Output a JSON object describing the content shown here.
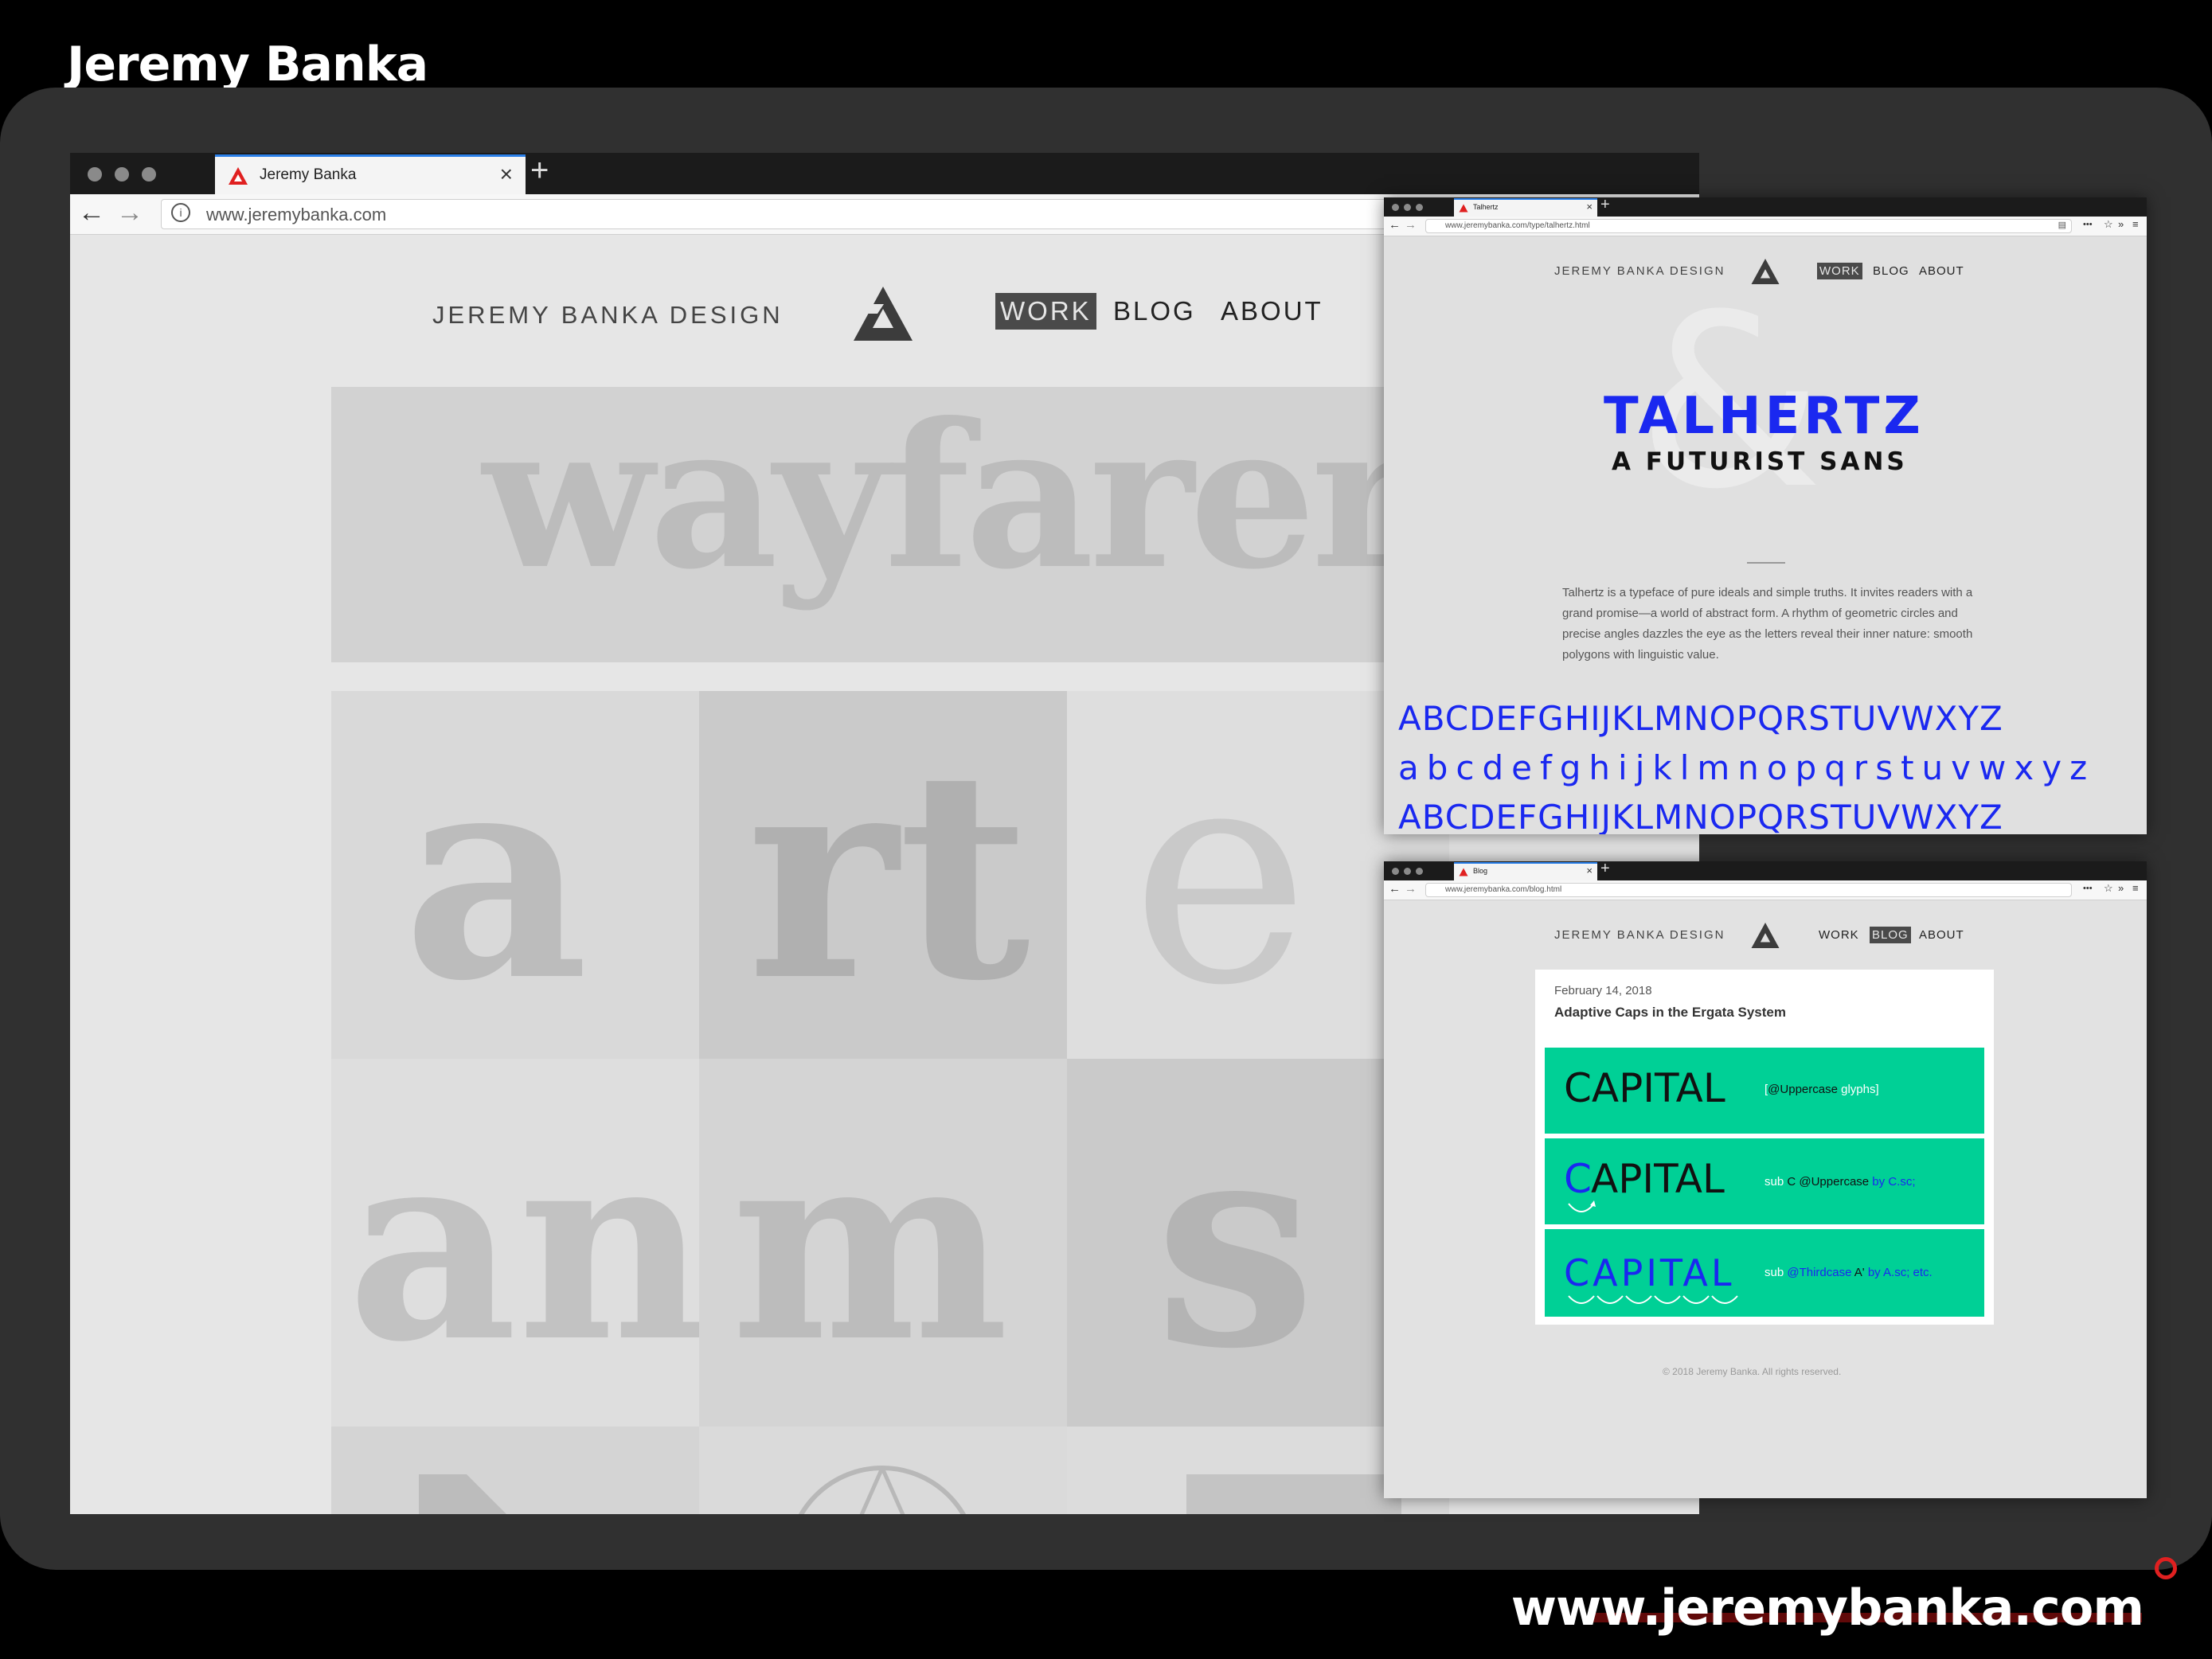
{
  "header": {
    "title": "Jeremy Banka"
  },
  "footer": {
    "url": "www.jeremybanka.com"
  },
  "main_browser": {
    "tab_title": "Jeremy Banka",
    "url": "www.jeremybanka.com",
    "site": {
      "name": "JEREMY BANKA DESIGN",
      "nav": [
        "WORK",
        "BLOG",
        "ABOUT"
      ],
      "active_nav": "WORK"
    },
    "tiles": {
      "banner": "wayfarer",
      "row1": [
        "a",
        "rt",
        "e"
      ],
      "row2": [
        "an",
        "m",
        "s"
      ]
    }
  },
  "talhertz_window": {
    "tab_title": "Talhertz",
    "url": "www.jeremybanka.com/type/talhertz.html",
    "site": {
      "name": "JEREMY BANKA DESIGN",
      "nav": [
        "WORK",
        "BLOG",
        "ABOUT"
      ],
      "active_nav": "WORK"
    },
    "ampersand": "&",
    "heading": "TALHERTZ",
    "subheading": "A FUTURIST SANS",
    "description": "Talhertz is a typeface of pure ideals and simple truths. It invites readers with a grand promise—a world of abstract form. A rhythm of geometric circles and precise angles dazzles the eye as the letters reveal their inner nature: smooth polygons with linguistic value.",
    "uppercase": "ABCDEFGHIJKLMNOPQRSTUVWXYZ",
    "lowercase": "abcdefghijklmnopqrstuvwxyz",
    "uppercase_repeat": "ABCDEFGHIJKLMNOPQRSTUVWXYZ"
  },
  "blog_window": {
    "tab_title": "Blog",
    "url": "www.jeremybanka.com/blog.html",
    "site": {
      "name": "JEREMY BANKA DESIGN",
      "nav": [
        "WORK",
        "BLOG",
        "ABOUT"
      ],
      "active_nav": "BLOG"
    },
    "post": {
      "date": "February 14, 2018",
      "title": "Adaptive Caps in the Ergata System",
      "rows": [
        {
          "word": "CAPITAL",
          "note_pre": "[",
          "note_a": "@Uppercase",
          "note_b": " glyphs]",
          "note_c": ""
        },
        {
          "word": "APITAL",
          "first": "C",
          "note_pre": "sub ",
          "note_a": "C",
          "note_b": " @Uppercase",
          "note_c": " by C.sc;"
        },
        {
          "word": "CAPITAL",
          "note_pre": "sub ",
          "note_a": "@Thirdcase",
          "note_b": " A'",
          "note_c": " by A.sc; etc."
        }
      ]
    },
    "copyright": "© 2018 Jeremy Banka. All rights reserved."
  },
  "colors": {
    "accent_blue": "#1a28f0",
    "teal": "#00d096",
    "brand_red": "#e02020"
  }
}
